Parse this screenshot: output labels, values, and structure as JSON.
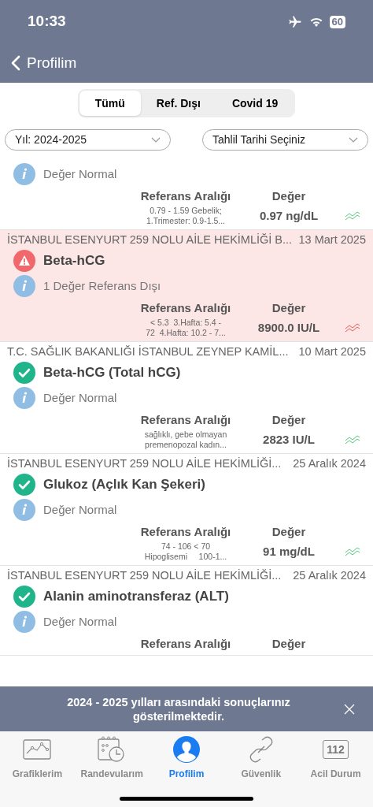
{
  "status_bar": {
    "time": "10:33",
    "battery": "60"
  },
  "nav": {
    "back_label": "Profilim"
  },
  "segments": [
    {
      "label": "Tümü",
      "selected": true
    },
    {
      "label": "Ref. Dışı",
      "selected": false
    },
    {
      "label": "Covid 19",
      "selected": false
    }
  ],
  "filters": [
    {
      "value": "Yıl: 2024-2025"
    },
    {
      "value": "Tahlil Tarihi Seçiniz"
    }
  ],
  "results": [
    {
      "info": "Değer Normal",
      "ref_header": "Referans Aralığı",
      "value_header": "Değer",
      "ref_range": "0.79 - 1.59 Gebelik;\n1.Trimester: 0.9-1.5...",
      "value": "0.97 ng/dL",
      "out_of_range": false
    },
    {
      "clinic": "İSTANBUL ESENYURT 259 NOLU AİLE HEKİMLİĞİ B...",
      "date": "13 Mart 2025",
      "title": "Beta-hCG",
      "info": "1 Değer Referans Dışı",
      "ref_header": "Referans Aralığı",
      "value_header": "Değer",
      "ref_range": "< 5.3  3.Hafta: 5.4 -\n72  4.Hafta: 10.2 - 7...",
      "value": "8900.0 IU/L",
      "out_of_range": true
    },
    {
      "clinic": "T.C. SAĞLIK BAKANLIĞI İSTANBUL ZEYNEP KAMİL...",
      "date": "10 Mart 2025",
      "title": "Beta-hCG (Total hCG)",
      "info": "Değer Normal",
      "ref_header": "Referans Aralığı",
      "value_header": "Değer",
      "ref_range": "sağlıklı, gebe olmayan\npremenopozal kadın...",
      "value": "2823 IU/L",
      "out_of_range": false
    },
    {
      "clinic": "İSTANBUL ESENYURT 259 NOLU AİLE HEKİMLİĞİ...",
      "date": "25 Aralık 2024",
      "title": "Glukoz (Açlık Kan Şekeri)",
      "info": "Değer Normal",
      "ref_header": "Referans Aralığı",
      "value_header": "Değer",
      "ref_range": "74 - 106 < 70\nHipoglisemi     100-1...",
      "value": "91 mg/dL",
      "out_of_range": false
    },
    {
      "clinic": "İSTANBUL ESENYURT 259 NOLU AİLE HEKİMLİĞİ...",
      "date": "25 Aralık 2024",
      "title": "Alanin aminotransferaz (ALT)",
      "info": "Değer Normal",
      "ref_header": "Referans Aralığı",
      "value_header": "Değer",
      "out_of_range": false
    }
  ],
  "banner": {
    "text": "2024 - 2025 yılları arasındaki sonuçlarınız gösterilmektedir."
  },
  "tab_bar": [
    {
      "kind": "chart",
      "label": "Grafiklerim",
      "selected": false
    },
    {
      "kind": "calendar",
      "label": "Randevularım",
      "selected": false
    },
    {
      "kind": "person",
      "label": "Profilim",
      "selected": true
    },
    {
      "kind": "link",
      "label": "Güvenlik",
      "selected": false
    },
    {
      "kind": "emergency",
      "label": "Acil Durum",
      "icon_text": "112",
      "selected": false
    }
  ]
}
